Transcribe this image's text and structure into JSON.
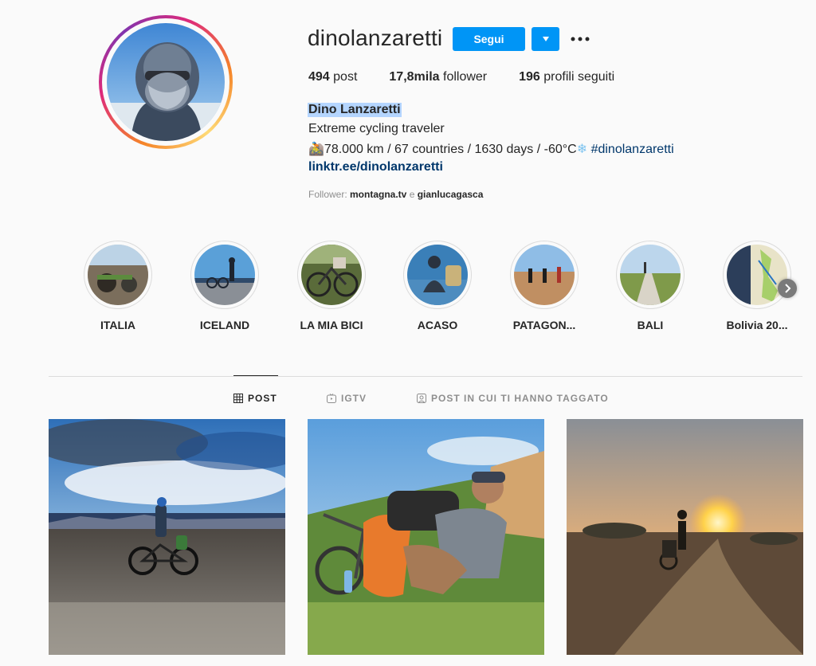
{
  "profile": {
    "username": "dinolanzaretti",
    "follow_label": "Segui",
    "posts_count": "494",
    "posts_label": " post",
    "followers_count": "17,8mila",
    "followers_label": " follower",
    "following_count": "196",
    "following_label": " profili seguiti",
    "full_name": "Dino Lanzaretti",
    "bio_line1": "Extreme cycling traveler",
    "bio_line2_prefix": "🚵78.000 km / 67 countries / 1630 days / -60°C",
    "bio_snow_emoji": "❄",
    "bio_hashtag": " #dinolanzaretti",
    "link": "linktr.ee/dinolanzaretti",
    "followed_by_label": "Follower: ",
    "followed_by_user1": "montagna.tv",
    "followed_by_sep": " e ",
    "followed_by_user2": "gianlucagasca"
  },
  "highlights": [
    {
      "label": "ITALIA"
    },
    {
      "label": "ICELAND"
    },
    {
      "label": "LA MIA BICI"
    },
    {
      "label": "ACASO"
    },
    {
      "label": "PATAGON..."
    },
    {
      "label": "BALI"
    },
    {
      "label": "Bolivia 20..."
    }
  ],
  "tabs": [
    {
      "label": "POST",
      "icon": "grid-icon",
      "active": true
    },
    {
      "label": "IGTV",
      "icon": "igtv-icon",
      "active": false
    },
    {
      "label": "POST IN CUI TI HANNO TAGGATO",
      "icon": "tagged-icon",
      "active": false
    }
  ],
  "colors": {
    "accent": "#0095f6",
    "link": "#00376b",
    "selection_highlight": "#b4d5fe",
    "muted": "#8e8e8e"
  }
}
